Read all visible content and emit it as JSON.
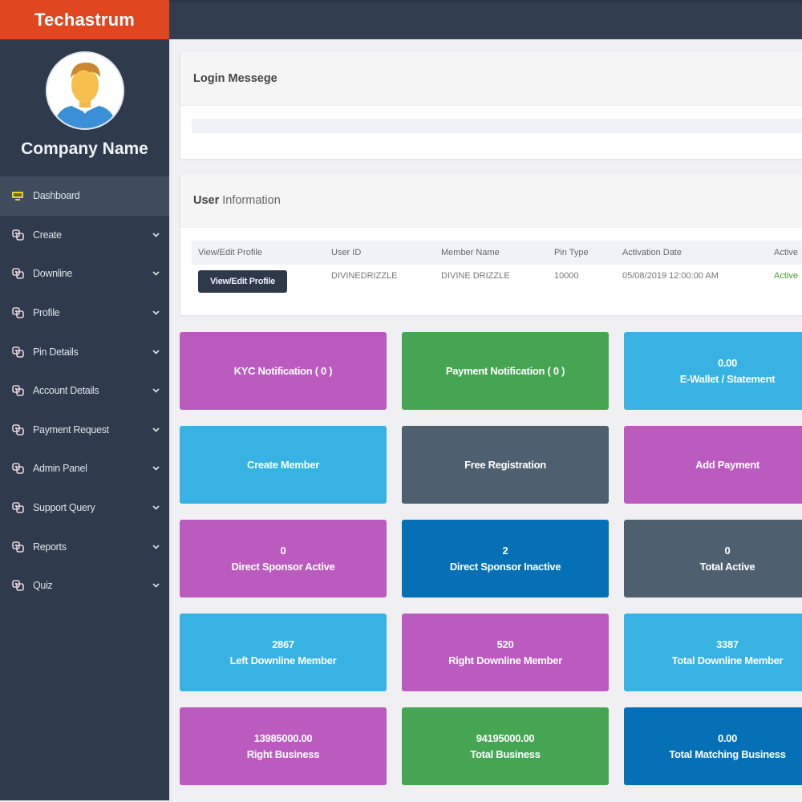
{
  "brand": {
    "name": "Techastrum",
    "color": "#e0461f"
  },
  "profile": {
    "company_name": "Company Name",
    "avatar_icon": "user-avatar-icon"
  },
  "sidebar": {
    "items": [
      {
        "label": "Dashboard",
        "icon": "monitor-icon",
        "active": true,
        "has_chevron": false
      },
      {
        "label": "Create",
        "icon": "users-icon",
        "has_chevron": true
      },
      {
        "label": "Downline",
        "icon": "users-icon",
        "has_chevron": true
      },
      {
        "label": "Profile",
        "icon": "users-icon",
        "has_chevron": true
      },
      {
        "label": "Pin Details",
        "icon": "users-icon",
        "has_chevron": true
      },
      {
        "label": "Account Details",
        "icon": "users-icon",
        "has_chevron": true
      },
      {
        "label": "Payment Request",
        "icon": "users-icon",
        "has_chevron": true
      },
      {
        "label": "Admin Panel",
        "icon": "users-icon",
        "has_chevron": true
      },
      {
        "label": "Support Query",
        "icon": "users-icon",
        "has_chevron": true
      },
      {
        "label": "Reports",
        "icon": "users-icon",
        "has_chevron": true
      },
      {
        "label": "Quiz",
        "icon": "users-icon",
        "has_chevron": true
      }
    ]
  },
  "login_panel": {
    "title": "Login Messege",
    "message": ""
  },
  "user_panel": {
    "title_bold": "User",
    "title_rest": "Information",
    "columns": [
      "View/Edit Profile",
      "User ID",
      "Member Name",
      "Pin Type",
      "Activation Date",
      "Active"
    ],
    "row": {
      "button_label": "View/Edit Profile",
      "user_id": "DIVINEDRIZZLE",
      "member_name": "DIVINE DRIZZLE",
      "pin_type": "10000",
      "activation_date": "05/08/2019 12:00:00 AM",
      "status": "Active"
    }
  },
  "tiles": [
    {
      "value": "",
      "label": "KYC Notification ( 0 )",
      "color": "purple"
    },
    {
      "value": "",
      "label": "Payment Notification ( 0 )",
      "color": "green"
    },
    {
      "value": "0.00",
      "label": "E-Wallet / Statement",
      "color": "sky"
    },
    {
      "value": "",
      "label": "Create Member",
      "color": "sky"
    },
    {
      "value": "",
      "label": "Free Registration",
      "color": "slate"
    },
    {
      "value": "",
      "label": "Add Payment",
      "color": "purple"
    },
    {
      "value": "0",
      "label": "Direct Sponsor Active",
      "color": "purple"
    },
    {
      "value": "2",
      "label": "Direct Sponsor Inactive",
      "color": "navy"
    },
    {
      "value": "0",
      "label": "Total Active",
      "color": "slate"
    },
    {
      "value": "2867",
      "label": "Left Downline Member",
      "color": "sky"
    },
    {
      "value": "520",
      "label": "Right Downline Member",
      "color": "purple"
    },
    {
      "value": "3387",
      "label": "Total Downline Member",
      "color": "sky"
    },
    {
      "value": "13985000.00",
      "label": "Right Business",
      "color": "purple"
    },
    {
      "value": "94195000.00",
      "label": "Total Business",
      "color": "green"
    },
    {
      "value": "0.00",
      "label": "Total Matching Business",
      "color": "navy"
    }
  ],
  "colors": {
    "purple": "#bb5bbf",
    "green": "#45a553",
    "sky": "#37b2e3",
    "slate": "#4e5f70",
    "navy": "#0670b6",
    "sidebar": "#2f3b4c",
    "status_active": "#4a9a2d"
  }
}
